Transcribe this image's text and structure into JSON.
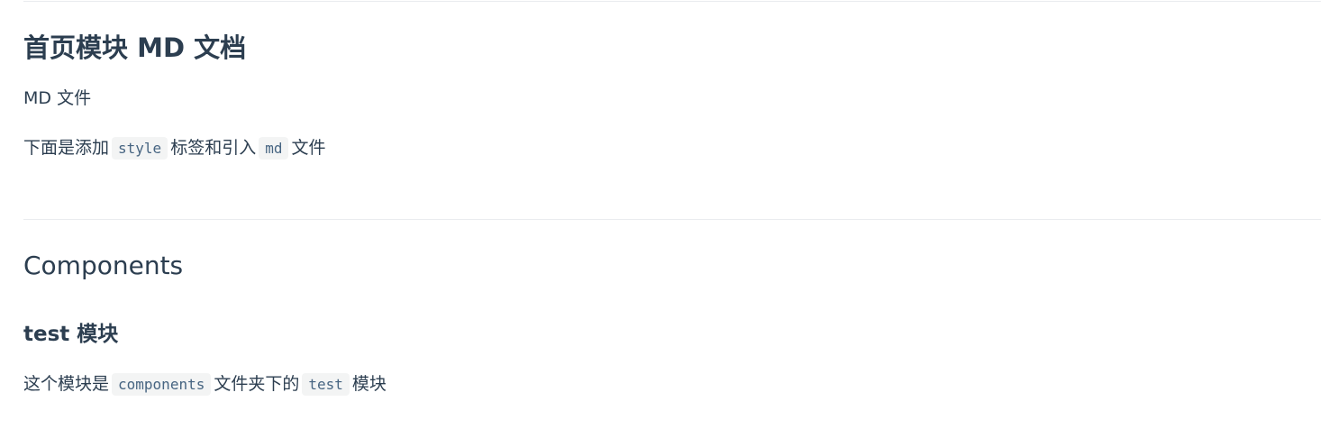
{
  "section1": {
    "heading": "首页模块 MD 文档",
    "paragraph1": "MD 文件",
    "paragraph2": {
      "text1": "下面是添加",
      "code1": "style",
      "text2": "标签和引入",
      "code2": "md",
      "text3": "文件"
    }
  },
  "section2": {
    "heading": "Components",
    "subheading": "test 模块",
    "paragraph": {
      "text1": "这个模块是",
      "code1": "components",
      "text2": "文件夹下的",
      "code2": "test",
      "text3": "模块"
    }
  },
  "colors": {
    "text": "#2c3e50",
    "code_text": "#476582",
    "rule": "#eaecef"
  }
}
